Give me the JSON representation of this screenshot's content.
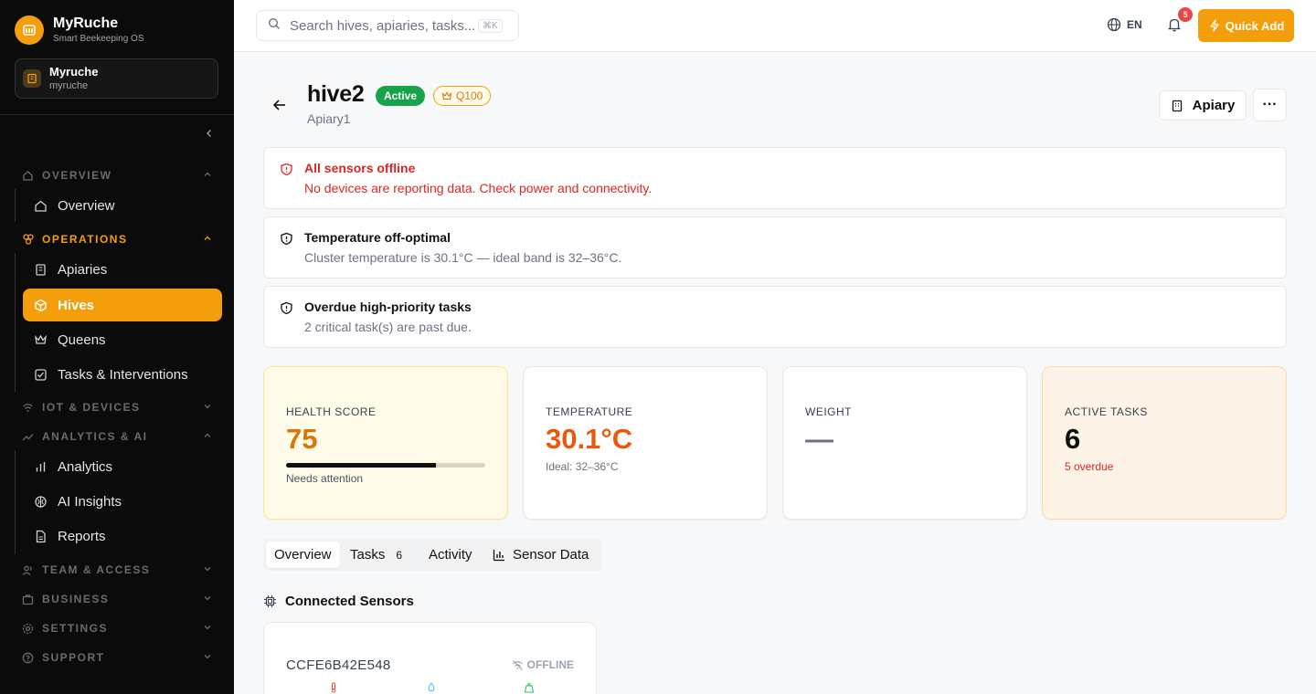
{
  "brand": {
    "name": "MyRuche",
    "tagline": "Smart Beekeeping OS"
  },
  "workspace": {
    "name": "Myruche",
    "slug": "myruche"
  },
  "nav": {
    "overview_section": "OVERVIEW",
    "overview_item": "Overview",
    "operations_section": "OPERATIONS",
    "apiaries": "Apiaries",
    "hives": "Hives",
    "queens": "Queens",
    "tasks": "Tasks & Interventions",
    "iot_section": "IOT & DEVICES",
    "analytics_section": "ANALYTICS & AI",
    "analytics": "Analytics",
    "ai_insights": "AI Insights",
    "reports": "Reports",
    "team_section": "TEAM & ACCESS",
    "business_section": "BUSINESS",
    "settings_section": "SETTINGS",
    "support_section": "SUPPORT"
  },
  "topbar": {
    "search_placeholder": "Search hives, apiaries, tasks...",
    "search_shortcut": "⌘K",
    "language": "EN",
    "notifications_count": "5",
    "quick_add": "Quick Add"
  },
  "header": {
    "title": "hive2",
    "status": "Active",
    "queen": "Q100",
    "apiary": "Apiary1",
    "apiary_button": "Apiary",
    "more": "···"
  },
  "alerts": [
    {
      "title": "All sensors offline",
      "detail": "No devices are reporting data. Check power and connectivity."
    },
    {
      "title": "Temperature off-optimal",
      "detail": "Cluster temperature is 30.1°C — ideal band is 32–36°C."
    },
    {
      "title": "Overdue high-priority tasks",
      "detail": "2 critical task(s) are past due."
    }
  ],
  "stats": {
    "health": {
      "label": "HEALTH SCORE",
      "value": "75",
      "score_pct": 75,
      "note": "Needs attention"
    },
    "temperature": {
      "label": "TEMPERATURE",
      "value": "30.1°C",
      "note": "Ideal: 32–36°C"
    },
    "weight": {
      "label": "WEIGHT",
      "value": "—"
    },
    "tasks": {
      "label": "ACTIVE TASKS",
      "value": "6",
      "note": "5 overdue"
    }
  },
  "tabs": [
    {
      "label": "Overview"
    },
    {
      "label": "Tasks",
      "count": "6"
    },
    {
      "label": "Activity"
    },
    {
      "label": "Sensor Data"
    }
  ],
  "sensors": {
    "heading": "Connected Sensors",
    "items": [
      {
        "id": "CCFE6B42E548",
        "status": "OFFLINE"
      }
    ]
  },
  "colors": {
    "accent": "#f59e0b",
    "danger": "#dc2626",
    "success": "#16a34a",
    "temp": "#ea580c"
  }
}
